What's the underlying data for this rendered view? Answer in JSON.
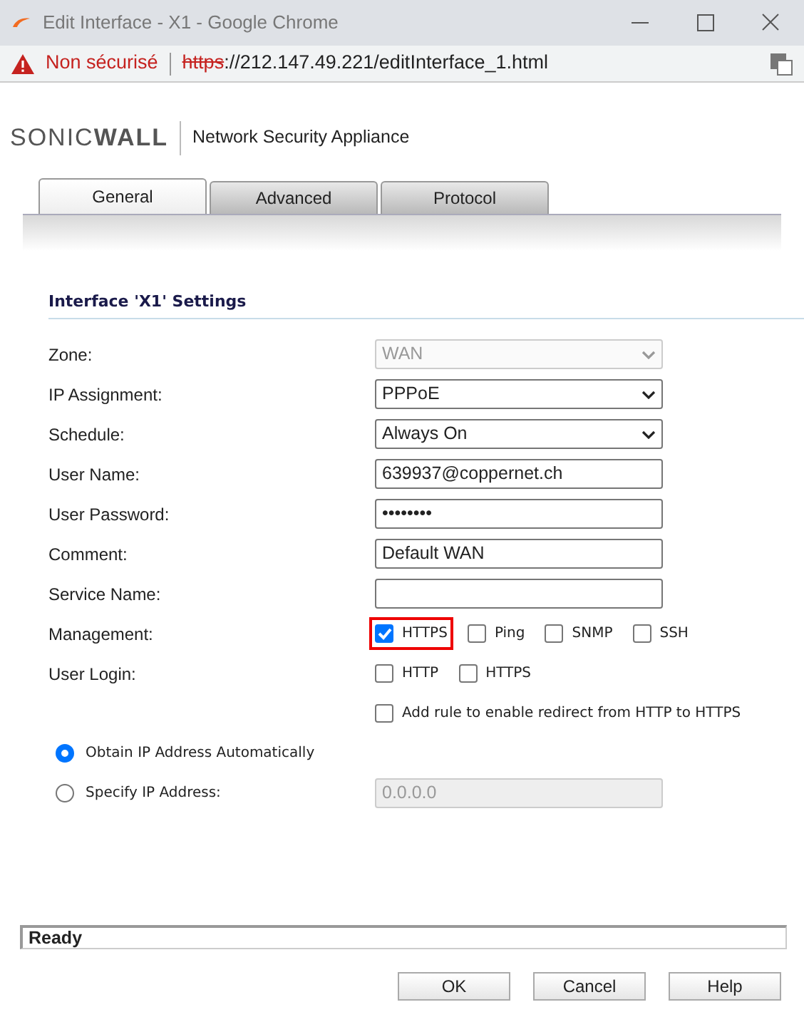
{
  "window": {
    "title": "Edit Interface - X1 - Google Chrome"
  },
  "address_bar": {
    "security": "Non sécurisé",
    "scheme": "https",
    "url_rest": "://212.147.49.221/editInterface_1.html"
  },
  "header": {
    "logo": "SONIC**WALL**",
    "product": "Network Security Appliance"
  },
  "tabs": [
    {
      "label": "General",
      "selected": true
    },
    {
      "label": "Advanced",
      "selected": false
    },
    {
      "label": "Protocol",
      "selected": false
    }
  ],
  "section_title": "Interface 'X1' Settings",
  "fields": [
    {
      "label": "Zone:",
      "kind": "select",
      "value": "WAN",
      "disabled": true
    },
    {
      "label": "IP Assignment:",
      "kind": "select",
      "value": "PPPoE",
      "disabled": false
    },
    {
      "label": "Schedule:",
      "kind": "select",
      "value": "Always On",
      "disabled": false
    },
    {
      "label": "User Name:",
      "kind": "text",
      "value": "639937@coppernet.ch"
    },
    {
      "label": "User Password:",
      "kind": "text",
      "value": "••••••••"
    },
    {
      "label": "Comment:",
      "kind": "text",
      "value": "Default WAN"
    },
    {
      "label": "Service Name:",
      "kind": "text"
    },
    {
      "label": "Management:",
      "kind": "checks",
      "options": [
        {
          "label": "HTTPS",
          "checked": true,
          "highlighted": true
        },
        {
          "label": "Ping",
          "checked": false,
          "highlighted": false
        },
        {
          "label": "SNMP",
          "checked": false,
          "highlighted": false
        },
        {
          "label": "SSH",
          "checked": false,
          "highlighted": false
        }
      ]
    },
    {
      "label": "User Login:",
      "kind": "checks",
      "options": [
        {
          "label": "HTTP",
          "checked": false,
          "highlighted": false
        },
        {
          "label": "HTTPS",
          "checked": false,
          "highlighted": false
        }
      ]
    },
    {
      "kind": "checks",
      "options": [
        {
          "label": "Add rule to enable redirect from HTTP to HTTPS",
          "checked": false,
          "highlighted": false
        }
      ]
    }
  ],
  "ip_modes": [
    {
      "label": "Obtain IP Address Automatically",
      "selected": true
    },
    {
      "label": "Specify IP Address:",
      "selected": false,
      "value": "0.0.0.0"
    }
  ],
  "status_bar": "Ready",
  "buttons": [
    "OK",
    "Cancel",
    "Help"
  ]
}
